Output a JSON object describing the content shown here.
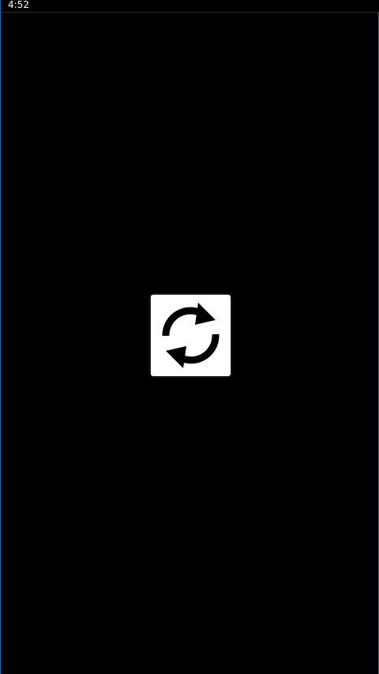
{
  "status_bar": {
    "time": "4:52"
  },
  "main": {
    "refresh_button": {
      "icon": "refresh-icon"
    }
  },
  "colors": {
    "background": "#000000",
    "tile": "#ffffff",
    "icon": "#000000",
    "edge_accent": "#1e6aa8"
  }
}
